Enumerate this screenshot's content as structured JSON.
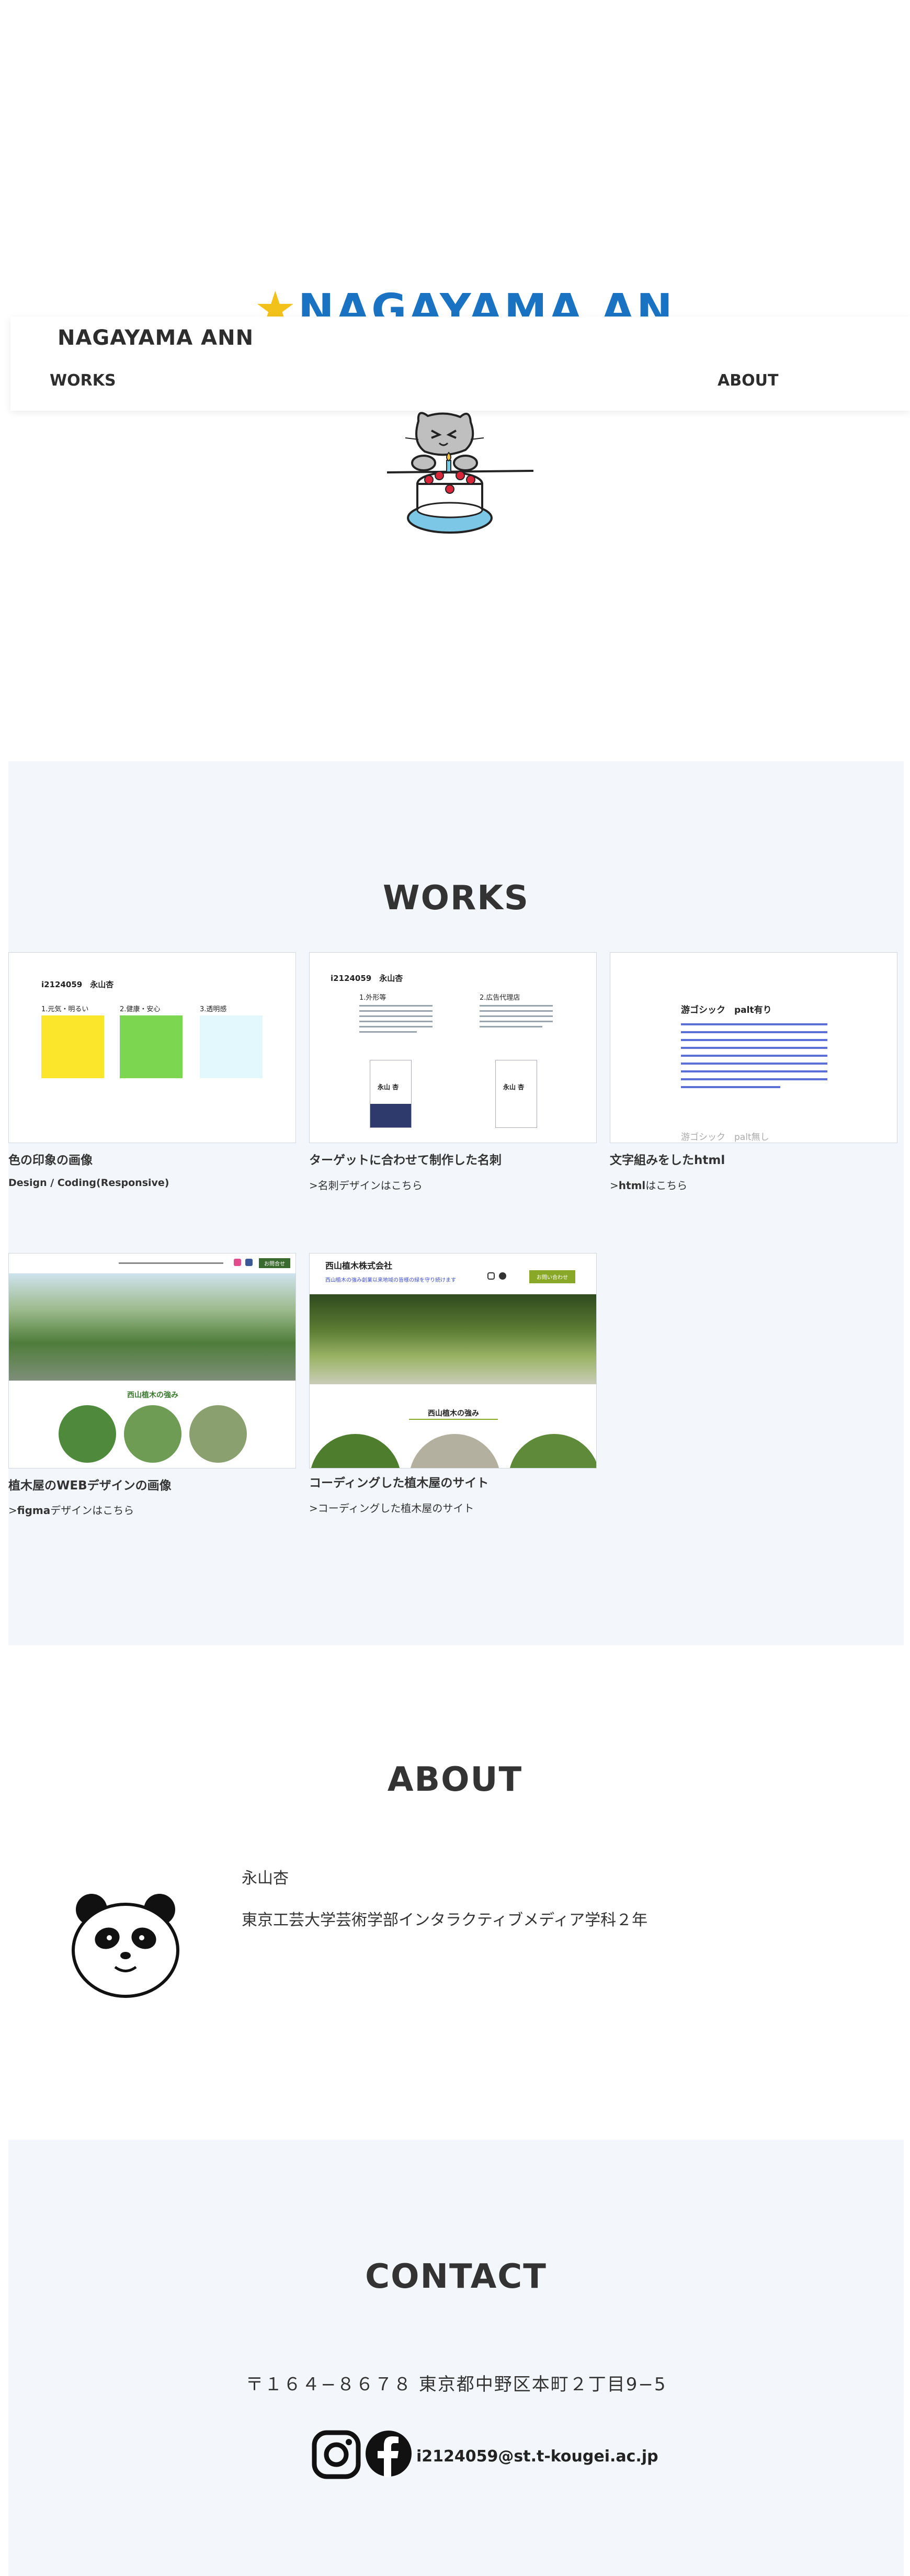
{
  "hero": {
    "logo_text": "NAGAYAMA ANN",
    "star_glyph": "★",
    "illustration": "cat-with-birthday-cake"
  },
  "header": {
    "site_title": "NAGAYAMA ANN",
    "nav": {
      "works": "WORKS",
      "about": "ABOUT"
    }
  },
  "works": {
    "title": "WORKS",
    "items": [
      {
        "title": "色の印象の画像",
        "subtitle": "Design / Coding(Responsive)",
        "thumb": {
          "header": "i2124059　永山杏",
          "labels": [
            "1.元気・明るい",
            "2.健康・安心",
            "3.透明感"
          ],
          "colors": [
            "#fbe62b",
            "#7dd64f",
            "#e3f8fc"
          ]
        }
      },
      {
        "title": "ターゲットに合わせて制作した名刺",
        "link_prefix": ">",
        "link_text": "名刺デザインはこちら",
        "thumb": {
          "header": "i2124059　永山杏",
          "col_a": "1.外形等",
          "col_b": "2.広告代理店",
          "card_name_a": "永山 杏",
          "card_name_b": "永山 杏"
        }
      },
      {
        "title_plain": "文字組みをした",
        "title_bold": "html",
        "link_prefix": ">",
        "link_bold": "html",
        "link_text": "はこちら",
        "thumb": {
          "heading": "游ゴシック　palt有り",
          "footer": "游ゴシック　palt無し"
        }
      },
      {
        "title_plain_a": "植木屋の",
        "title_bold": "WEB",
        "title_plain_b": "デザインの画像",
        "link_prefix": ">",
        "link_bold": "figma",
        "link_text": "デザインはこちら",
        "thumb": {
          "section_heading": "西山植木の強み",
          "button": "お問合せ"
        }
      },
      {
        "title": "コーディングした植木屋のサイト",
        "link_prefix": ">",
        "link_text": "コーディングした植木屋のサイト",
        "thumb": {
          "company": "西山植木株式会社",
          "tagline": "西山植木の強み創業以来地域の皆様の緑を守り続けます",
          "button": "お問い合わせ",
          "section_heading": "西山植木の強み"
        }
      }
    ]
  },
  "about": {
    "title": "ABOUT",
    "name": "永山杏",
    "department": "東京工芸大学芸術学部インタラクティブメディア学科２年",
    "illustration": "panda-face"
  },
  "contact": {
    "title": "CONTACT",
    "address": "〒１６４−８６７８ 東京都中野区本町２丁目9−5",
    "email": "i2124059@st.t-kougei.ac.jp",
    "icons": [
      "instagram-icon",
      "facebook-icon"
    ]
  }
}
